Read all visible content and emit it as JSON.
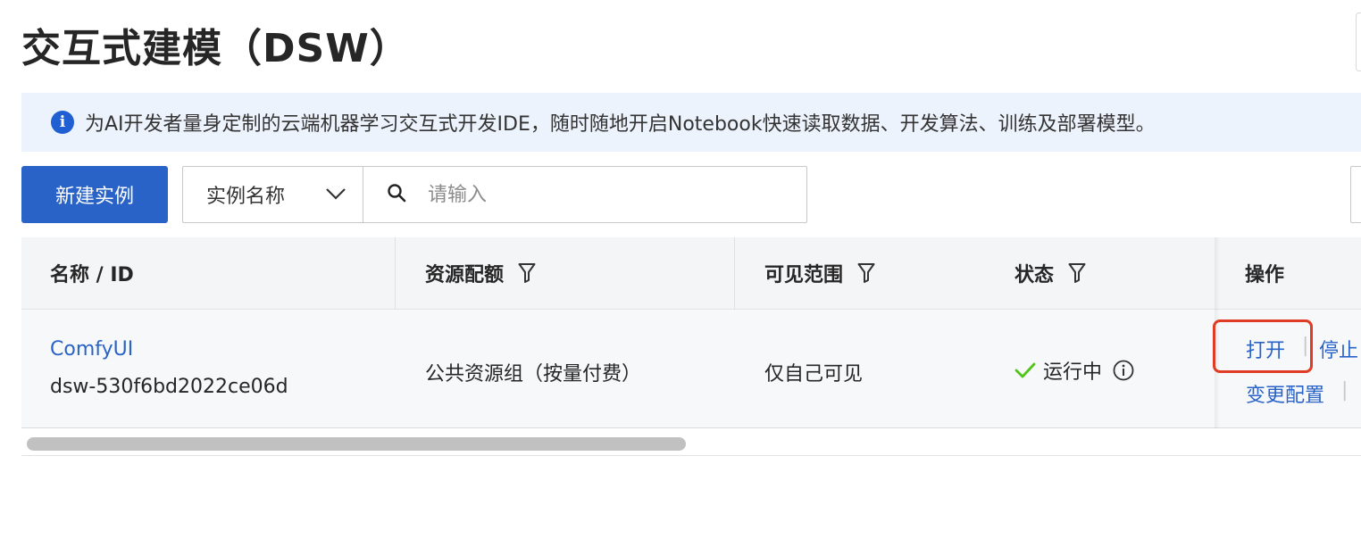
{
  "page": {
    "title": "交互式建模（DSW）"
  },
  "banner": {
    "icon": "info-icon",
    "text": "为AI开发者量身定制的云端机器学习交互式开发IDE，随时随地开启Notebook快速读取数据、开发算法、训练及部署模型。"
  },
  "toolbar": {
    "create_label": "新建实例",
    "field_select": "实例名称",
    "search_placeholder": "请输入"
  },
  "table": {
    "headers": {
      "name": "名称 / ID",
      "resource": "资源配额",
      "visibility": "可见范围",
      "status": "状态",
      "actions": "操作"
    },
    "rows": [
      {
        "name": "ComfyUI",
        "id": "dsw-530f6bd2022ce06d",
        "resource": "公共资源组（按量付费）",
        "visibility": "仅自己可见",
        "status": "运行中",
        "actions": {
          "open": "打开",
          "stop": "停止",
          "config": "变更配置"
        }
      }
    ]
  },
  "colors": {
    "primary": "#2a63c8",
    "banner_bg": "#edf3fd",
    "status_ok": "#52c41a",
    "highlight": "#e03b24"
  }
}
